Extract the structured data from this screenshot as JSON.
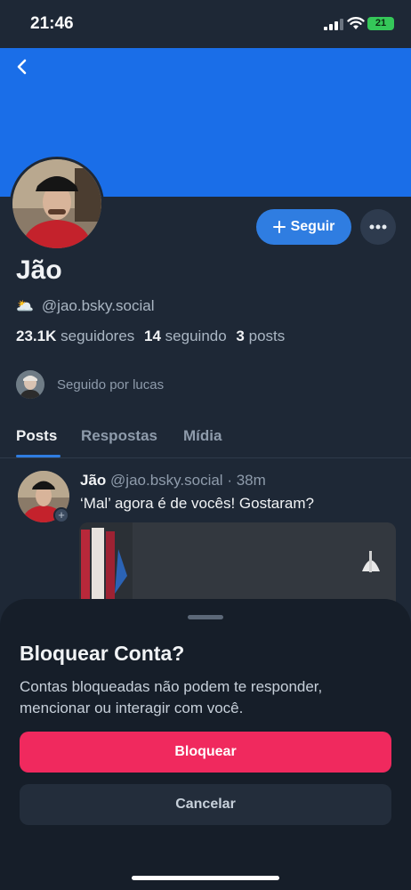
{
  "status_bar": {
    "time": "21:46",
    "battery": "21"
  },
  "profile": {
    "display_name": "Jão",
    "handle": "@jao.bsky.social",
    "handle_emoji": "🌥️",
    "followers_count": "23.1K",
    "followers_label": "seguidores",
    "following_count": "14",
    "following_label": "seguindo",
    "posts_count": "3",
    "posts_label": "posts",
    "followed_by": "Seguido por lucas",
    "follow_label": "Seguir"
  },
  "tabs": [
    {
      "label": "Posts",
      "active": true
    },
    {
      "label": "Respostas",
      "active": false
    },
    {
      "label": "Mídia",
      "active": false
    }
  ],
  "post": {
    "author": "Jão",
    "handle": "@jao.bsky.social",
    "separator": "·",
    "time": "38m",
    "text": "‘Mal’ agora é de vocês! Gostaram?"
  },
  "sheet": {
    "title": "Bloquear Conta?",
    "description": "Contas bloqueadas não podem te responder, mencionar ou interagir com você.",
    "confirm_label": "Bloquear",
    "cancel_label": "Cancelar"
  },
  "colors": {
    "banner": "#1a6ee8",
    "accent": "#2f7de1",
    "danger": "#f0295e",
    "background": "#1e2836",
    "sheet": "#161e29"
  }
}
